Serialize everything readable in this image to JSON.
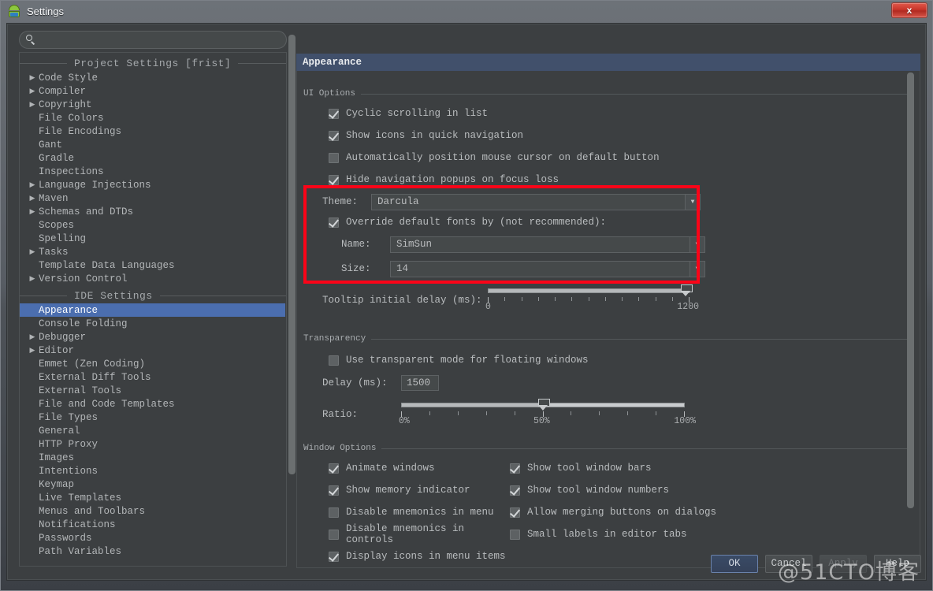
{
  "window": {
    "title": "Settings",
    "app_icon": "android-robot-icon",
    "close_label": "x",
    "watermark": "@51CTO博客",
    "colors": {
      "background": "#3c3f41",
      "header_blue": "#41506b",
      "selection_blue": "#4b6eaf",
      "highlight_red": "#fb0418",
      "text": "#b9bcbe"
    }
  },
  "sidebar": {
    "search": {
      "value": "",
      "placeholder": ""
    },
    "groups": [
      {
        "label": "Project Settings [frist]",
        "items": [
          {
            "label": "Code Style",
            "expandable": true
          },
          {
            "label": "Compiler",
            "expandable": true
          },
          {
            "label": "Copyright",
            "expandable": true
          },
          {
            "label": "File Colors",
            "expandable": false
          },
          {
            "label": "File Encodings",
            "expandable": false
          },
          {
            "label": "Gant",
            "expandable": false
          },
          {
            "label": "Gradle",
            "expandable": false
          },
          {
            "label": "Inspections",
            "expandable": false
          },
          {
            "label": "Language Injections",
            "expandable": true
          },
          {
            "label": "Maven",
            "expandable": true
          },
          {
            "label": "Schemas and DTDs",
            "expandable": true
          },
          {
            "label": "Scopes",
            "expandable": false
          },
          {
            "label": "Spelling",
            "expandable": false
          },
          {
            "label": "Tasks",
            "expandable": true
          },
          {
            "label": "Template Data Languages",
            "expandable": false
          },
          {
            "label": "Version Control",
            "expandable": true
          }
        ]
      },
      {
        "label": "IDE Settings",
        "items": [
          {
            "label": "Appearance",
            "expandable": false,
            "selected": true
          },
          {
            "label": "Console Folding",
            "expandable": false
          },
          {
            "label": "Debugger",
            "expandable": true
          },
          {
            "label": "Editor",
            "expandable": true
          },
          {
            "label": "Emmet (Zen Coding)",
            "expandable": false
          },
          {
            "label": "External Diff Tools",
            "expandable": false
          },
          {
            "label": "External Tools",
            "expandable": false
          },
          {
            "label": "File and Code Templates",
            "expandable": false
          },
          {
            "label": "File Types",
            "expandable": false
          },
          {
            "label": "General",
            "expandable": false
          },
          {
            "label": "HTTP Proxy",
            "expandable": false
          },
          {
            "label": "Images",
            "expandable": false
          },
          {
            "label": "Intentions",
            "expandable": false
          },
          {
            "label": "Keymap",
            "expandable": false
          },
          {
            "label": "Live Templates",
            "expandable": false
          },
          {
            "label": "Menus and Toolbars",
            "expandable": false
          },
          {
            "label": "Notifications",
            "expandable": false
          },
          {
            "label": "Passwords",
            "expandable": false
          },
          {
            "label": "Path Variables",
            "expandable": false
          }
        ]
      }
    ]
  },
  "panel": {
    "header": "Appearance",
    "ui_options": {
      "title": "UI Options",
      "checks": [
        {
          "label": "Cyclic scrolling in list",
          "checked": true
        },
        {
          "label": "Show icons in quick navigation",
          "checked": true
        },
        {
          "label": "Automatically position mouse cursor on default button",
          "checked": false
        },
        {
          "label": "Hide navigation popups on focus loss",
          "checked": true
        }
      ],
      "theme_label": "Theme:",
      "theme_value": "Darcula",
      "override_fonts_label": "Override default fonts by (not recommended):",
      "override_fonts_checked": true,
      "font_name_label": "Name:",
      "font_name_value": "SimSun",
      "font_size_label": "Size:",
      "font_size_value": "14",
      "tooltip_delay_label": "Tooltip initial delay (ms):",
      "tooltip_delay_min": "0",
      "tooltip_delay_max": "1200",
      "tooltip_delay_value": 1200
    },
    "transparency": {
      "title": "Transparency",
      "use_transparent_label": "Use transparent mode for floating windows",
      "use_transparent_checked": false,
      "delay_label": "Delay (ms):",
      "delay_value": "1500",
      "ratio_label": "Ratio:",
      "ratio_min": "0%",
      "ratio_mid": "50%",
      "ratio_max": "100%",
      "ratio_value": 50
    },
    "window_options": {
      "title": "Window Options",
      "left_checks": [
        {
          "label": "Animate windows",
          "checked": true
        },
        {
          "label": "Show memory indicator",
          "checked": true
        },
        {
          "label": "Disable mnemonics in menu",
          "checked": false
        },
        {
          "label": "Disable mnemonics in controls",
          "checked": false
        },
        {
          "label": "Display icons in menu items",
          "checked": true
        }
      ],
      "right_checks": [
        {
          "label": "Show tool window bars",
          "checked": true
        },
        {
          "label": "Show tool window numbers",
          "checked": true
        },
        {
          "label": "Allow merging buttons on dialogs",
          "checked": true
        },
        {
          "label": "Small labels in editor tabs",
          "checked": false
        }
      ]
    }
  },
  "buttons": {
    "ok": "OK",
    "cancel": "Cancel",
    "apply": "Apply",
    "help": "Help"
  }
}
